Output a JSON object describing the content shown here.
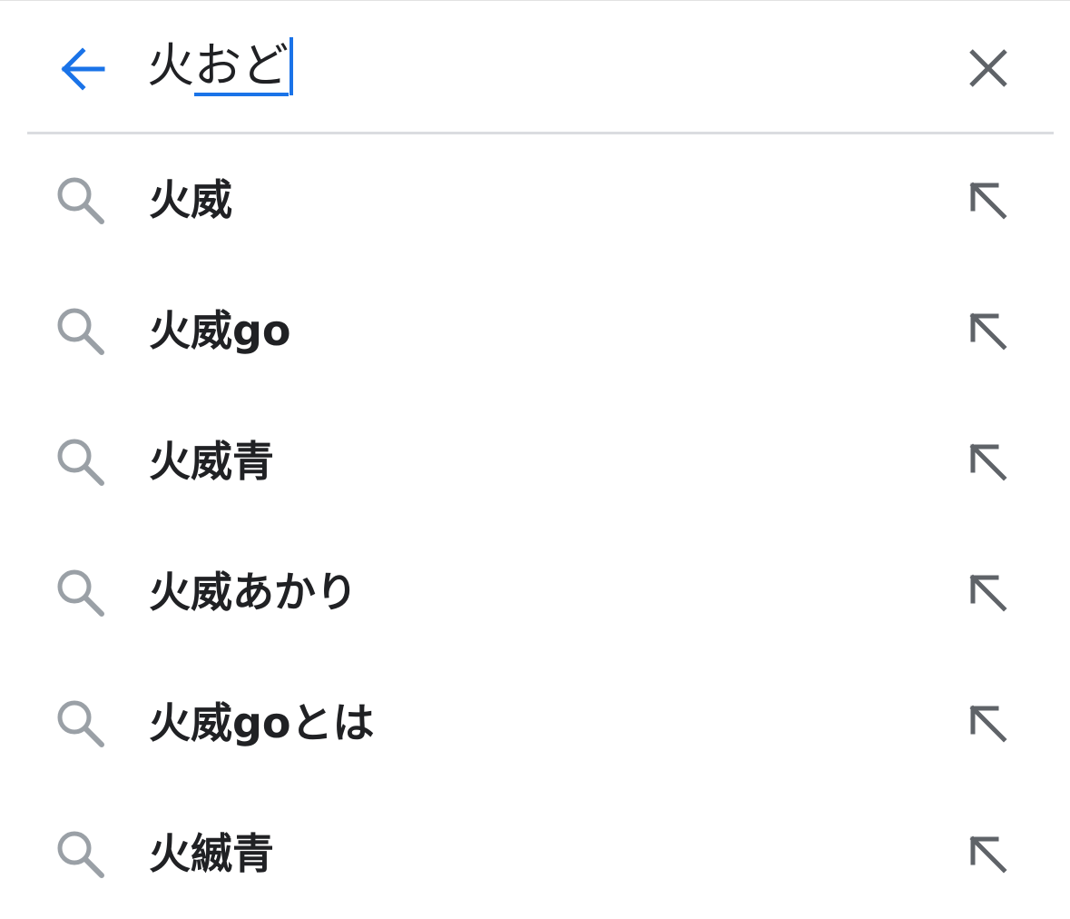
{
  "search": {
    "query_committed": "火",
    "query_composing": "おど"
  },
  "suggestions": [
    {
      "text": "火威",
      "icon": "search-icon",
      "action_icon": "arrow-up-left-icon"
    },
    {
      "text": "火威go",
      "icon": "search-icon",
      "action_icon": "arrow-up-left-icon"
    },
    {
      "text": "火威青",
      "icon": "search-icon",
      "action_icon": "arrow-up-left-icon"
    },
    {
      "text": "火威あかり",
      "icon": "search-icon",
      "action_icon": "arrow-up-left-icon"
    },
    {
      "text": "火威goとは",
      "icon": "search-icon",
      "action_icon": "arrow-up-left-icon"
    },
    {
      "text": "火縅青",
      "icon": "search-icon",
      "action_icon": "arrow-up-left-icon"
    }
  ],
  "colors": {
    "accent": "#1a73e8",
    "text": "#202124",
    "icon_gray": "#9aa0a6",
    "close_gray": "#5f6368",
    "divider": "#dadce0"
  }
}
